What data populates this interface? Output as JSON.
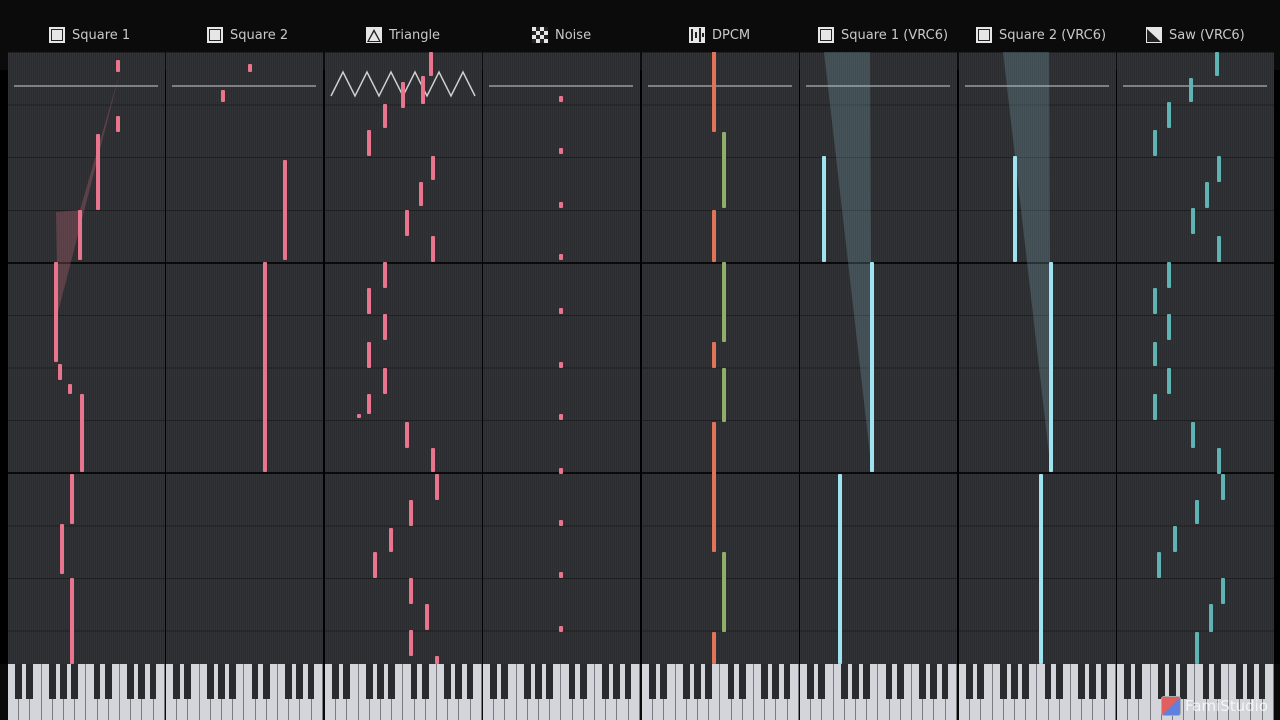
{
  "channels": [
    {
      "name": "Square 1",
      "icon": "square-wave-icon",
      "color": "#e8748d"
    },
    {
      "name": "Square 2",
      "icon": "square-wave-icon",
      "color": "#e8748d"
    },
    {
      "name": "Triangle",
      "icon": "triangle-wave-icon",
      "color": "#e8748d"
    },
    {
      "name": "Noise",
      "icon": "noise-icon",
      "color": "#e8748d"
    },
    {
      "name": "DPCM",
      "icon": "dpcm-icon",
      "color": "#e07358"
    },
    {
      "name": "Square 1 (VRC6)",
      "icon": "square-wave-icon",
      "color": "#9fe3f0"
    },
    {
      "name": "Square 2 (VRC6)",
      "icon": "square-wave-icon",
      "color": "#9fe3f0"
    },
    {
      "name": "Saw (VRC6)",
      "icon": "saw-wave-icon",
      "color": "#5fb3b3"
    }
  ],
  "logo": {
    "text": "FamiStudio"
  }
}
